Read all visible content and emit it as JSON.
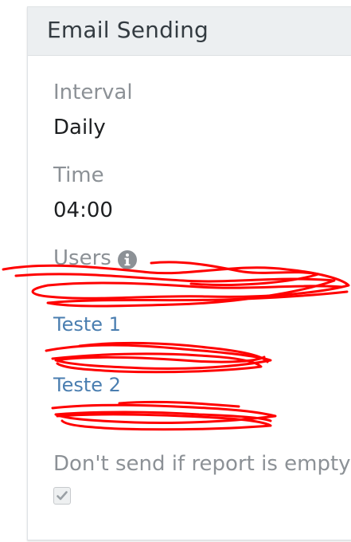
{
  "panel": {
    "title": "Email Sending"
  },
  "fields": {
    "interval": {
      "label": "Interval",
      "value": "Daily"
    },
    "time": {
      "label": "Time",
      "value": "04:00"
    },
    "users": {
      "label": "Users",
      "icon": "info-circle-icon",
      "items": [
        {
          "label": "Teste 1"
        },
        {
          "label": "Teste 2"
        }
      ]
    },
    "empty_report": {
      "label": "Don't send if report is empty",
      "checked": true
    }
  },
  "colors": {
    "header_bg": "#eceff1",
    "link": "#4a7eb0",
    "label": "#8c9196",
    "redaction": "#ff0000"
  }
}
